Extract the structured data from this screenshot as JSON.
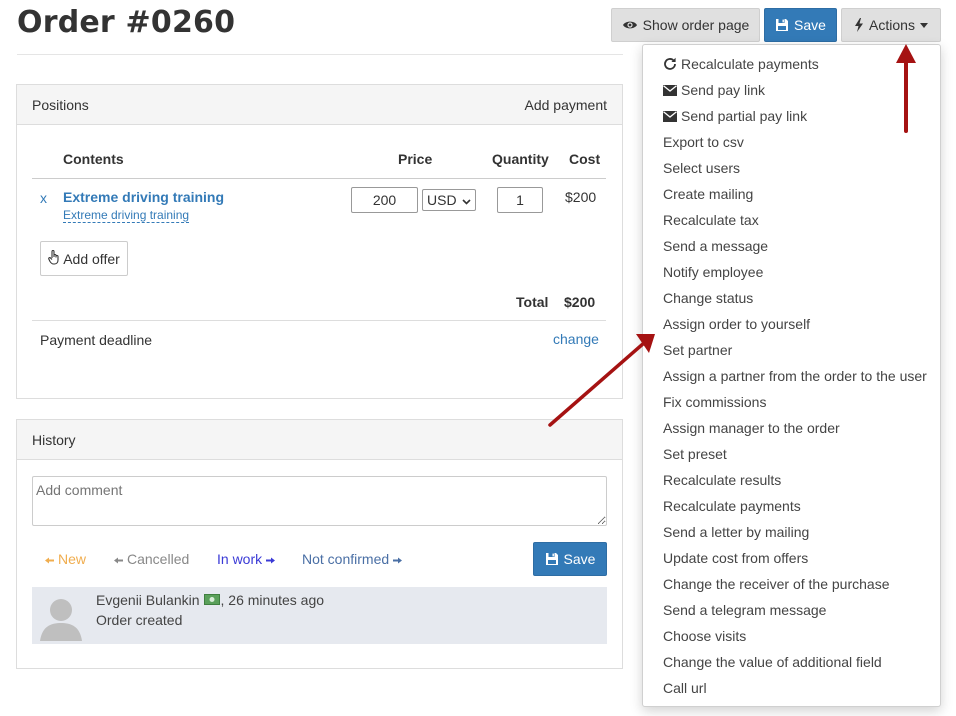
{
  "page": {
    "title": "Order #0260"
  },
  "header_buttons": {
    "show_order_page": "Show order page",
    "save": "Save",
    "actions": "Actions"
  },
  "positions": {
    "heading": "Positions",
    "add_payment": "Add payment",
    "columns": {
      "contents": "Contents",
      "price": "Price",
      "quantity": "Quantity",
      "cost": "Cost"
    },
    "rows": [
      {
        "remove": "x",
        "title": "Extreme driving training",
        "subtitle": "Extreme driving training",
        "price": "200",
        "currency": "USD",
        "quantity": "1",
        "cost": "$200"
      }
    ],
    "add_offer": "Add offer",
    "total_label": "Total",
    "total_value": "$200",
    "deadline_label": "Payment deadline",
    "deadline_action": "change"
  },
  "history": {
    "heading": "History",
    "comment_placeholder": "Add comment",
    "statuses": {
      "new": "New",
      "cancelled": "Cancelled",
      "in_work": "In work",
      "not_confirmed": "Not confirmed"
    },
    "save": "Save",
    "entry": {
      "author": "Evgenii Bulankin",
      "time": ", 26 minutes ago",
      "text": "Order created"
    }
  },
  "actions_menu": {
    "items": [
      "Recalculate payments",
      "Send pay link",
      "Send partial pay link",
      "Export to csv",
      "Select users",
      "Create mailing",
      "Recalculate tax",
      "Send a message",
      "Notify employee",
      "Change status",
      "Assign order to yourself",
      "Set partner",
      "Assign a partner from the order to the user",
      "Fix commissions",
      "Assign manager to the order",
      "Set preset",
      "Recalculate results",
      "Recalculate payments",
      "Send a letter by mailing",
      "Update cost from offers",
      "Change the receiver of the purchase",
      "Send a telegram message",
      "Choose visits",
      "Change the value of additional field",
      "Call url"
    ],
    "icons": {
      "recalculate": "refresh-icon",
      "pay_link": "envelope-icon",
      "partial_pay_link": "envelope-icon"
    }
  },
  "colors": {
    "primary": "#337ab7",
    "annotation_arrow": "#a51212",
    "status_new": "#f0ad4e",
    "status_cancelled": "#888888",
    "status_in_work": "#3a3ad6"
  }
}
